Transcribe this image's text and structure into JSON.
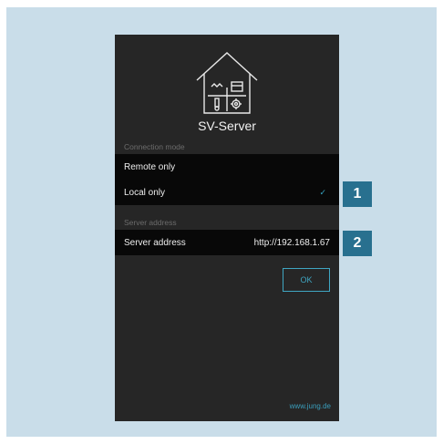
{
  "app": {
    "title": "SV-Server"
  },
  "connection_mode": {
    "header": "Connection mode",
    "options": [
      {
        "label": "Remote only",
        "selected": false
      },
      {
        "label": "Local only",
        "selected": true
      }
    ],
    "check_glyph": "✓"
  },
  "server": {
    "header": "Server address",
    "row_label": "Server address",
    "row_value": "http://192.168.1.67"
  },
  "actions": {
    "ok_label": "OK"
  },
  "footer": {
    "link": "www.jung.de"
  },
  "callouts": {
    "first": "1",
    "second": "2"
  },
  "colors": {
    "accent": "#3fa6c2",
    "background": "#c9dde9",
    "screen": "#262626",
    "callout": "#28708f"
  }
}
